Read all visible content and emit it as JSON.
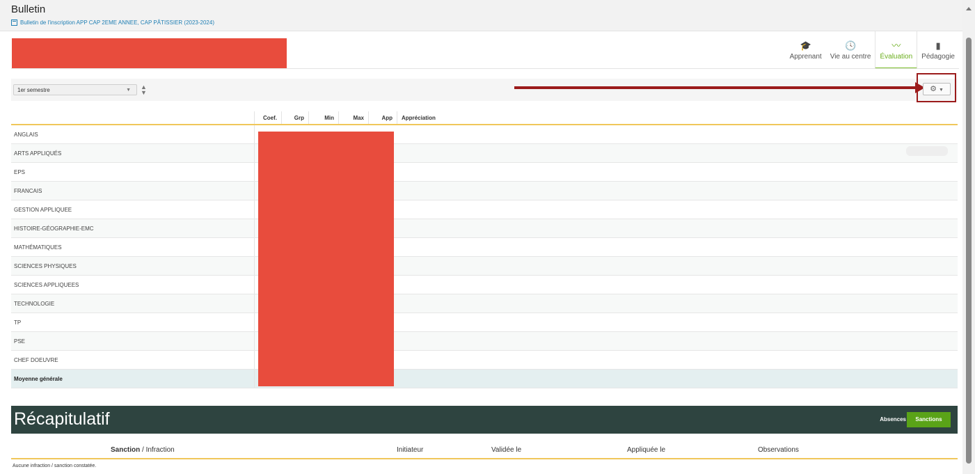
{
  "page": {
    "title": "Bulletin",
    "subtitle": "Bulletin de l'inscription APP CAP 2EME ANNEE, CAP PÂTISSIER (2023-2024)"
  },
  "tabs": [
    {
      "label": "Apprenant",
      "icon": "graduation-cap-icon",
      "glyph": "🎓",
      "active": false
    },
    {
      "label": "Vie au centre",
      "icon": "clock-icon",
      "glyph": "🕓",
      "active": false
    },
    {
      "label": "Évaluation",
      "icon": "chart-line-icon",
      "glyph": "〰",
      "active": true
    },
    {
      "label": "Pédagogie",
      "icon": "book-icon",
      "glyph": "▮",
      "active": false
    }
  ],
  "toolbar": {
    "period": "1er semestre",
    "settings_icon": "gear-icon"
  },
  "grades": {
    "columns": [
      "Coef.",
      "Grp",
      "Min",
      "Max",
      "App",
      "Appréciation"
    ],
    "rows": [
      "ANGLAIS",
      "ARTS APPLIQUÉS",
      "EPS",
      "FRANCAIS",
      "GESTION APPLIQUEE",
      "HISTOIRE-GÉOGRAPHIE-EMC",
      "MATHÉMATIQUES",
      "SCIENCES PHYSIQUES",
      "SCIENCES APPLIQUEES",
      "TECHNOLOGIE",
      "TP",
      "PSE",
      "CHEF DOEUVRE"
    ],
    "average_label": "Moyenne générale"
  },
  "recap": {
    "title": "Récapitulatif",
    "absences": "Absences",
    "sanctions": "Sanctions",
    "columns": {
      "sanction": "Sanction",
      "infraction": " / Infraction",
      "initiateur": "Initiateur",
      "validee": "Validée le",
      "appliquee": "Appliquée le",
      "observations": "Observations"
    },
    "empty": "Aucune infraction / sanction constatée."
  },
  "colors": {
    "accent_green": "#6aae1c",
    "header_dark": "#2e4440",
    "highlight_red": "#9b1b1b",
    "redaction": "#e84c3d"
  }
}
